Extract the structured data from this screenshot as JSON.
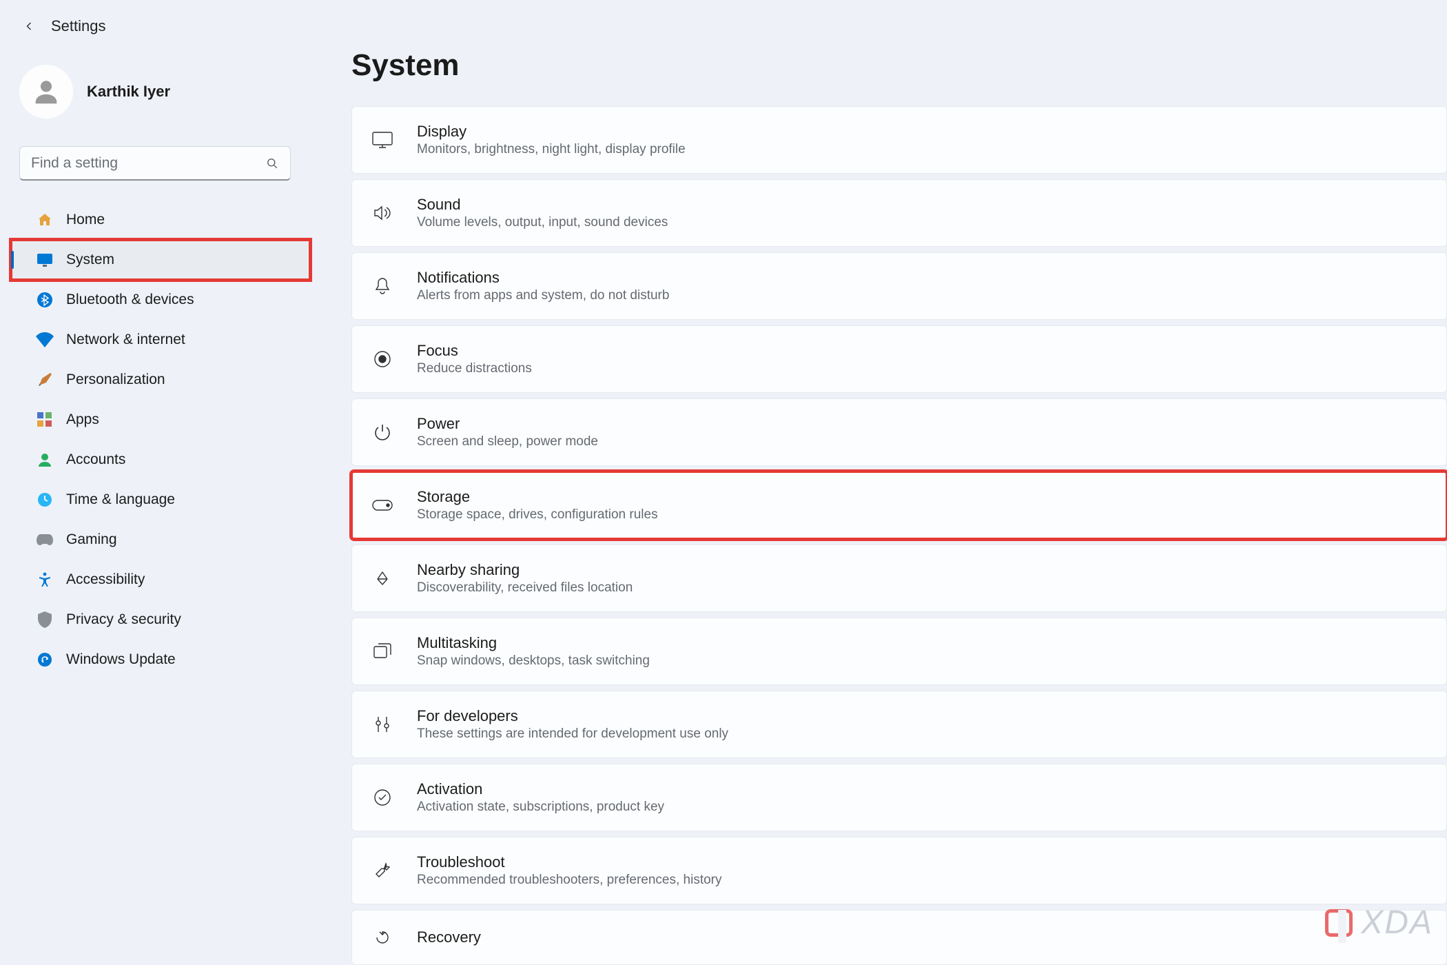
{
  "header": {
    "title": "Settings"
  },
  "user": {
    "name": "Karthik Iyer"
  },
  "search": {
    "placeholder": "Find a setting"
  },
  "sidebar": {
    "items": [
      {
        "id": "home",
        "label": "Home"
      },
      {
        "id": "system",
        "label": "System",
        "active": true,
        "highlighted": true
      },
      {
        "id": "bluetooth",
        "label": "Bluetooth & devices"
      },
      {
        "id": "network",
        "label": "Network & internet"
      },
      {
        "id": "personalization",
        "label": "Personalization"
      },
      {
        "id": "apps",
        "label": "Apps"
      },
      {
        "id": "accounts",
        "label": "Accounts"
      },
      {
        "id": "time",
        "label": "Time & language"
      },
      {
        "id": "gaming",
        "label": "Gaming"
      },
      {
        "id": "accessibility",
        "label": "Accessibility"
      },
      {
        "id": "privacy",
        "label": "Privacy & security"
      },
      {
        "id": "update",
        "label": "Windows Update"
      }
    ]
  },
  "page": {
    "heading": "System",
    "settings": [
      {
        "id": "display",
        "title": "Display",
        "desc": "Monitors, brightness, night light, display profile"
      },
      {
        "id": "sound",
        "title": "Sound",
        "desc": "Volume levels, output, input, sound devices"
      },
      {
        "id": "notifications",
        "title": "Notifications",
        "desc": "Alerts from apps and system, do not disturb"
      },
      {
        "id": "focus",
        "title": "Focus",
        "desc": "Reduce distractions"
      },
      {
        "id": "power",
        "title": "Power",
        "desc": "Screen and sleep, power mode"
      },
      {
        "id": "storage",
        "title": "Storage",
        "desc": "Storage space, drives, configuration rules",
        "highlighted": true
      },
      {
        "id": "nearby",
        "title": "Nearby sharing",
        "desc": "Discoverability, received files location"
      },
      {
        "id": "multitasking",
        "title": "Multitasking",
        "desc": "Snap windows, desktops, task switching"
      },
      {
        "id": "developers",
        "title": "For developers",
        "desc": "These settings are intended for development use only"
      },
      {
        "id": "activation",
        "title": "Activation",
        "desc": "Activation state, subscriptions, product key"
      },
      {
        "id": "troubleshoot",
        "title": "Troubleshoot",
        "desc": "Recommended troubleshooters, preferences, history"
      },
      {
        "id": "recovery",
        "title": "Recovery",
        "desc": ""
      }
    ]
  },
  "watermark": {
    "text": "XDA"
  },
  "colors": {
    "accent": "#0067c0",
    "highlight": "#e53935",
    "bg": "#eef2f8",
    "card": "#fcfdfe"
  }
}
